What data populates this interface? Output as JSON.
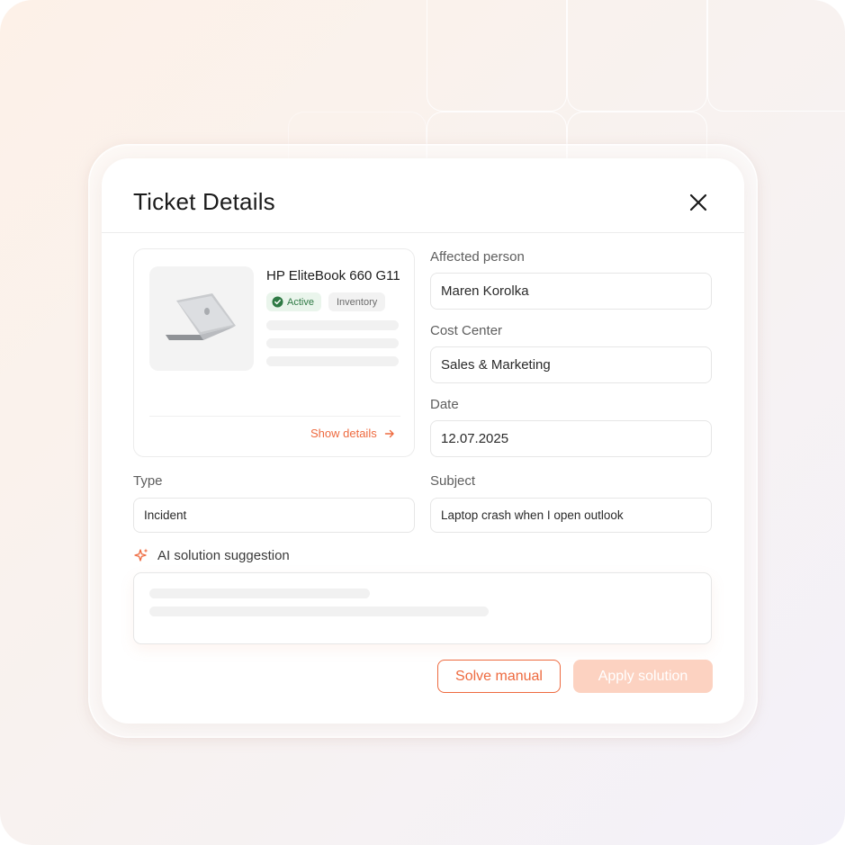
{
  "dialog": {
    "title": "Ticket Details",
    "close_icon": "close-icon"
  },
  "product": {
    "name": "HP EliteBook 660 G11",
    "image_icon": "laptop-image",
    "status_badge": "Active",
    "status_icon": "check-circle-icon",
    "category_badge": "Inventory",
    "show_details_label": "Show details",
    "show_details_icon": "arrow-right-icon"
  },
  "fields": {
    "affected_person": {
      "label": "Affected person",
      "value": "Maren Korolka"
    },
    "cost_center": {
      "label": "Cost Center",
      "value": "Sales & Marketing"
    },
    "date": {
      "label": "Date",
      "value": "12.07.2025"
    },
    "type": {
      "label": "Type",
      "value": "Incident"
    },
    "subject": {
      "label": "Subject",
      "value": "Laptop crash when I open outlook"
    }
  },
  "ai": {
    "label": "AI solution suggestion",
    "icon": "sparkle-icon"
  },
  "actions": {
    "solve_manual": "Solve manual",
    "apply_solution": "Apply solution"
  },
  "colors": {
    "accent": "#ee6a3f",
    "accent_light": "#fcd2c1",
    "success": "#2f7a45"
  }
}
